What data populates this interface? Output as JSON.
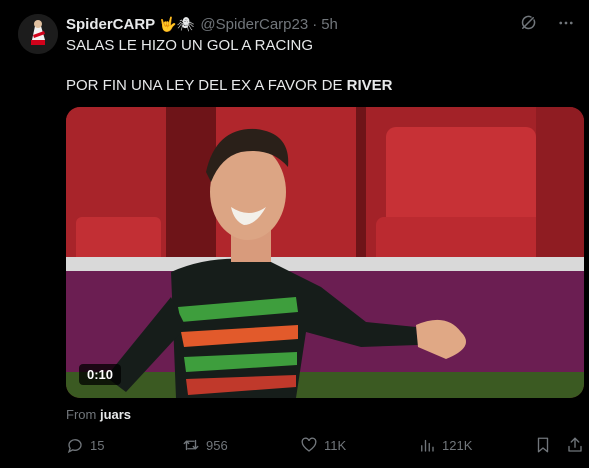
{
  "post": {
    "display_name": "SpiderCARP",
    "name_emoji": "🤟🕷",
    "handle": "@SpiderCarp23",
    "separator": "·",
    "time": "5h",
    "line1": "SALAS LE HIZO UN GOL A RACING",
    "line2_prefix": "POR FIN UNA LEY DEL EX A FAVOR DE ",
    "line2_bold": "RIVER"
  },
  "media": {
    "type": "video",
    "duration": "0:10"
  },
  "source": {
    "prefix": "From ",
    "name": "juars"
  },
  "actions": {
    "replies": "15",
    "reposts": "956",
    "likes": "11K",
    "views": "121K"
  },
  "colors": {
    "background": "#000000",
    "text": "#e7e9ea",
    "muted": "#71767b"
  },
  "icons": [
    "grok-icon",
    "more-icon",
    "reply-icon",
    "repost-icon",
    "like-icon",
    "views-icon",
    "bookmark-icon",
    "share-icon"
  ]
}
